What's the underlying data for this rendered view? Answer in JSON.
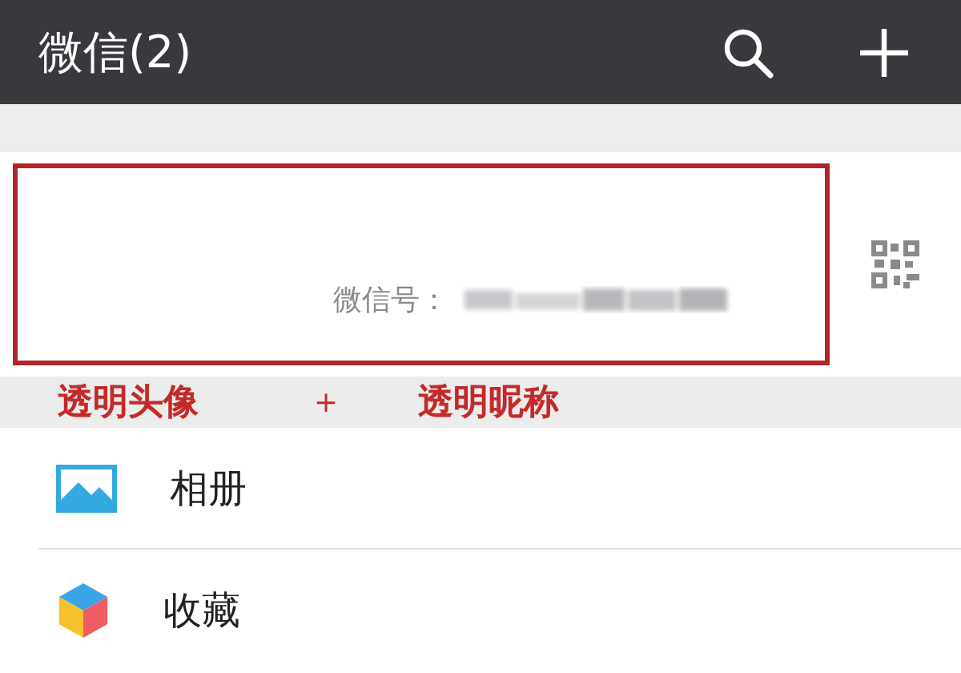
{
  "header": {
    "title": "微信(2)"
  },
  "profile": {
    "wechat_id_label": "微信号："
  },
  "annotation": {
    "left": "透明头像",
    "plus": "+",
    "right": "透明昵称"
  },
  "menu": [
    {
      "label": "相册",
      "kind": "album"
    },
    {
      "label": "收藏",
      "kind": "favorites"
    }
  ]
}
